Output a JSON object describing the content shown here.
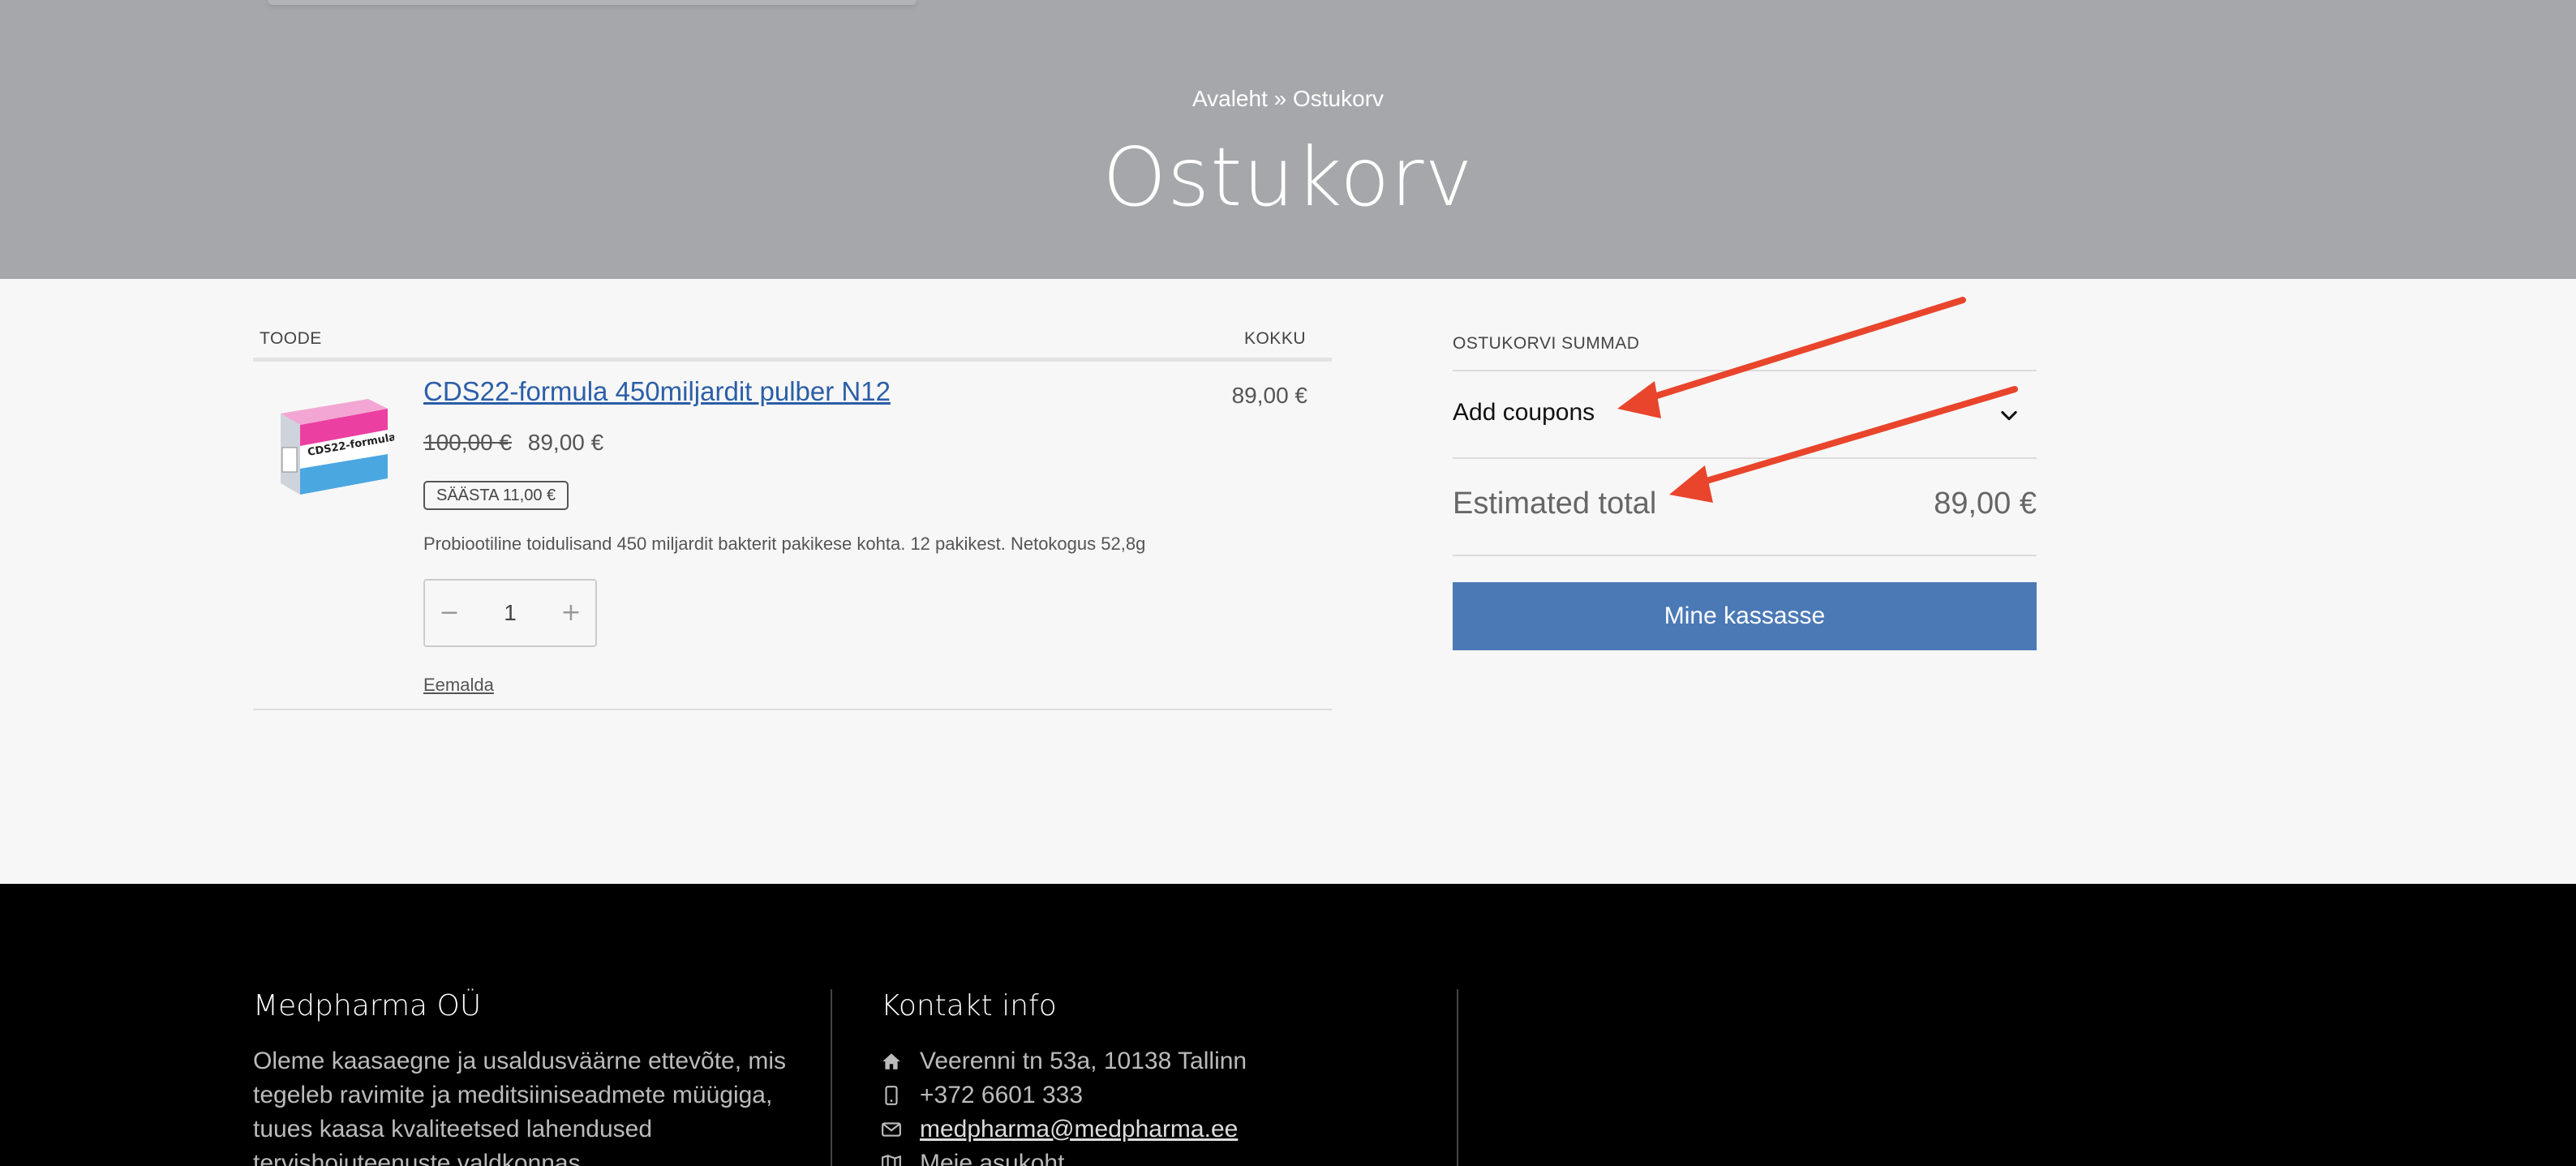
{
  "hero": {
    "breadcrumb": "Avaleht » Ostukorv",
    "title": "Ostukorv"
  },
  "cart": {
    "columns": {
      "product": "TOODE",
      "total": "KOKKU"
    },
    "items": [
      {
        "name": "CDS22-formula 450miljardit pulber N12",
        "old_price": "100,00 €",
        "price": "89,00 €",
        "save_badge": "SÄÄSTA 11,00 €",
        "description": "Probiootiline toidulisand 450 miljardit bakterit pakikese kohta. 12 pakikest. Netokogus 52,8g",
        "quantity": "1",
        "line_total": "89,00 €",
        "remove_label": "Eemalda",
        "thumb_label": "CDS22-formula"
      }
    ]
  },
  "totals": {
    "title": "OSTUKORVI SUMMAD",
    "coupons_label": "Add coupons",
    "estimated_label": "Estimated total",
    "estimated_value": "89,00 €",
    "checkout_label": "Mine kassasse"
  },
  "colors": {
    "hero_bg": "#a6a7ab",
    "accent_button": "#4b79b6",
    "link": "#2b5ea7",
    "annotation_arrow": "#e8452c",
    "footer_bg": "#000000"
  },
  "footer": {
    "company_title": "Medpharma OÜ",
    "company_text": "Oleme kaasaegne ja usaldusväärne ettevõte, mis tegeleb ravimite ja meditsiiniseadmete müügiga, tuues kaasa kvaliteetsed lahendused tervishoiuteenuste valdkonnas.",
    "contact_title": "Kontakt info",
    "address": "Veerenni tn 53a, 10138 Tallinn",
    "phone": "+372 6601 333",
    "email": "medpharma@medpharma.ee",
    "locations": "Meie asukoht"
  }
}
